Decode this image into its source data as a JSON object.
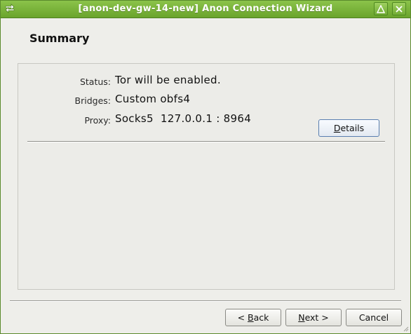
{
  "window": {
    "title": "[anon-dev-gw-14-new] Anon Connection Wizard",
    "accent": "#7ab83e"
  },
  "header": {
    "title": "Summary"
  },
  "summary": {
    "status_label": "Status:",
    "status_value": "Tor will be enabled.",
    "bridges_label": "Bridges:",
    "bridges_value": "Custom obfs4",
    "proxy_label": "Proxy:",
    "proxy_value": "Socks5  127.0.0.1 : 8964",
    "details_label_prefix": "",
    "details_mnemonic": "D",
    "details_label_rest": "etails"
  },
  "footer": {
    "back_prefix": "< ",
    "back_mnemonic": "B",
    "back_rest": "ack",
    "next_mnemonic": "N",
    "next_rest": "ext >",
    "cancel_label": "Cancel"
  },
  "icons": {
    "app": "arrows-swap-icon",
    "maximize": "maximize-icon",
    "close": "close-icon"
  }
}
